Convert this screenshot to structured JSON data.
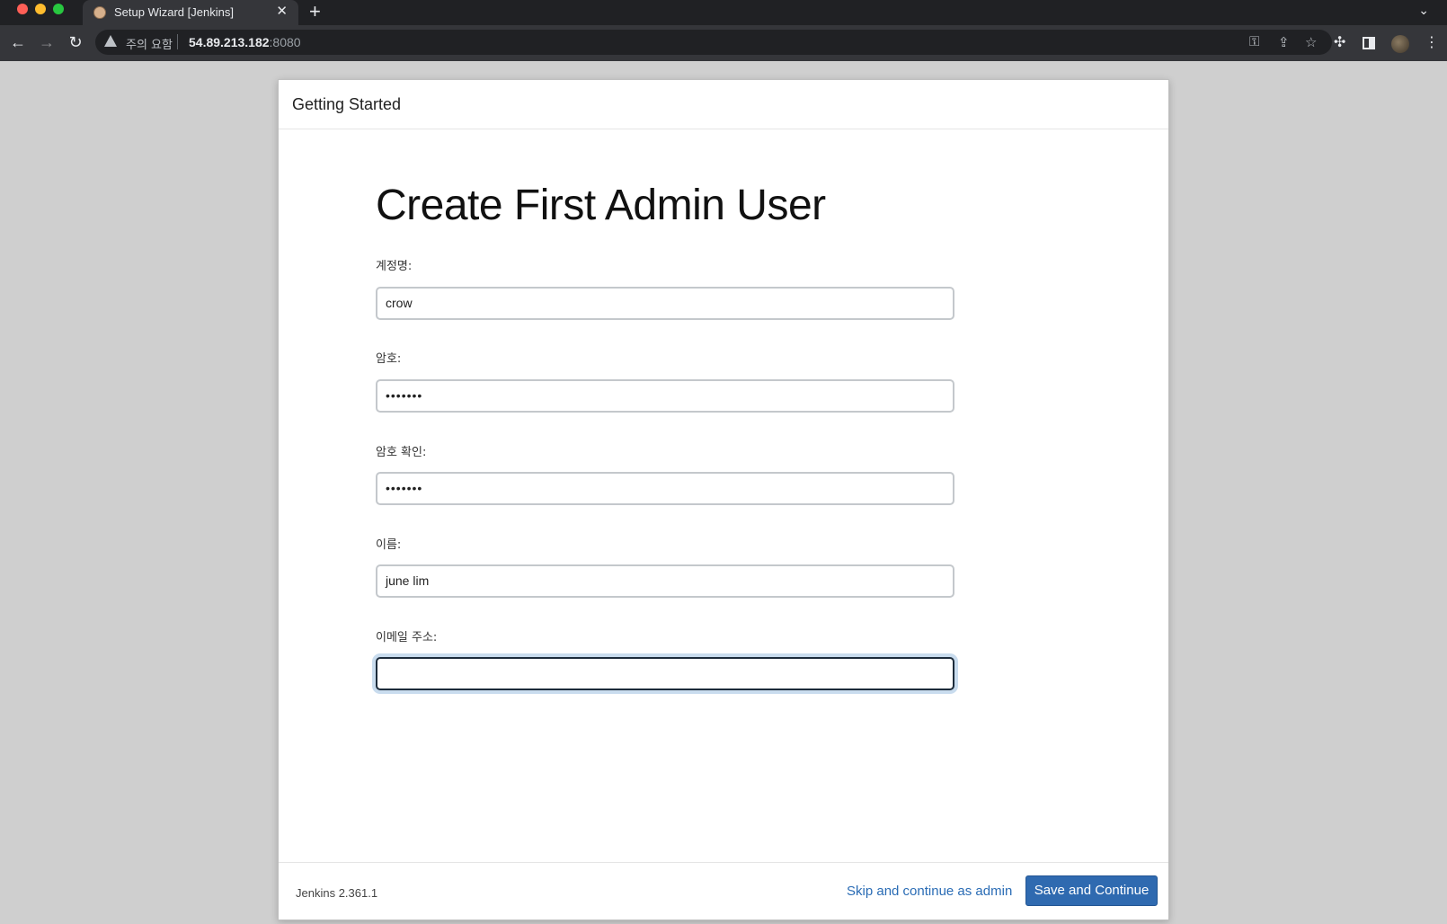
{
  "browser": {
    "tab_title": "Setup Wizard [Jenkins]",
    "tab_close": "✕",
    "new_tab": "+",
    "tab_menu": "⌄",
    "security_warning": "주의 요함",
    "url_host": "54.89.213.182",
    "url_port": ":8080",
    "icons": {
      "back": "←",
      "forward": "→",
      "reload": "↻",
      "key": "⚿",
      "share": "⇪",
      "star": "☆",
      "extensions": "✣",
      "menu": "⋮"
    }
  },
  "dialog": {
    "header_title": "Getting Started",
    "heading": "Create First Admin User",
    "fields": [
      {
        "label": "계정명:",
        "value": "crow",
        "type": "text"
      },
      {
        "label": "암호:",
        "value": "•••••••",
        "type": "password"
      },
      {
        "label": "암호 확인:",
        "value": "•••••••",
        "type": "password"
      },
      {
        "label": "이름:",
        "value": "june lim",
        "type": "text"
      },
      {
        "label": "이메일 주소:",
        "value": "",
        "type": "email",
        "focused": true
      }
    ],
    "footer": {
      "version": "Jenkins 2.361.1",
      "skip_label": "Skip and continue as admin",
      "save_label": "Save and Continue"
    }
  },
  "colors": {
    "primary_button": "#2f6ab0",
    "link": "#2a6cb5",
    "page_background": "#cfcfcf"
  }
}
